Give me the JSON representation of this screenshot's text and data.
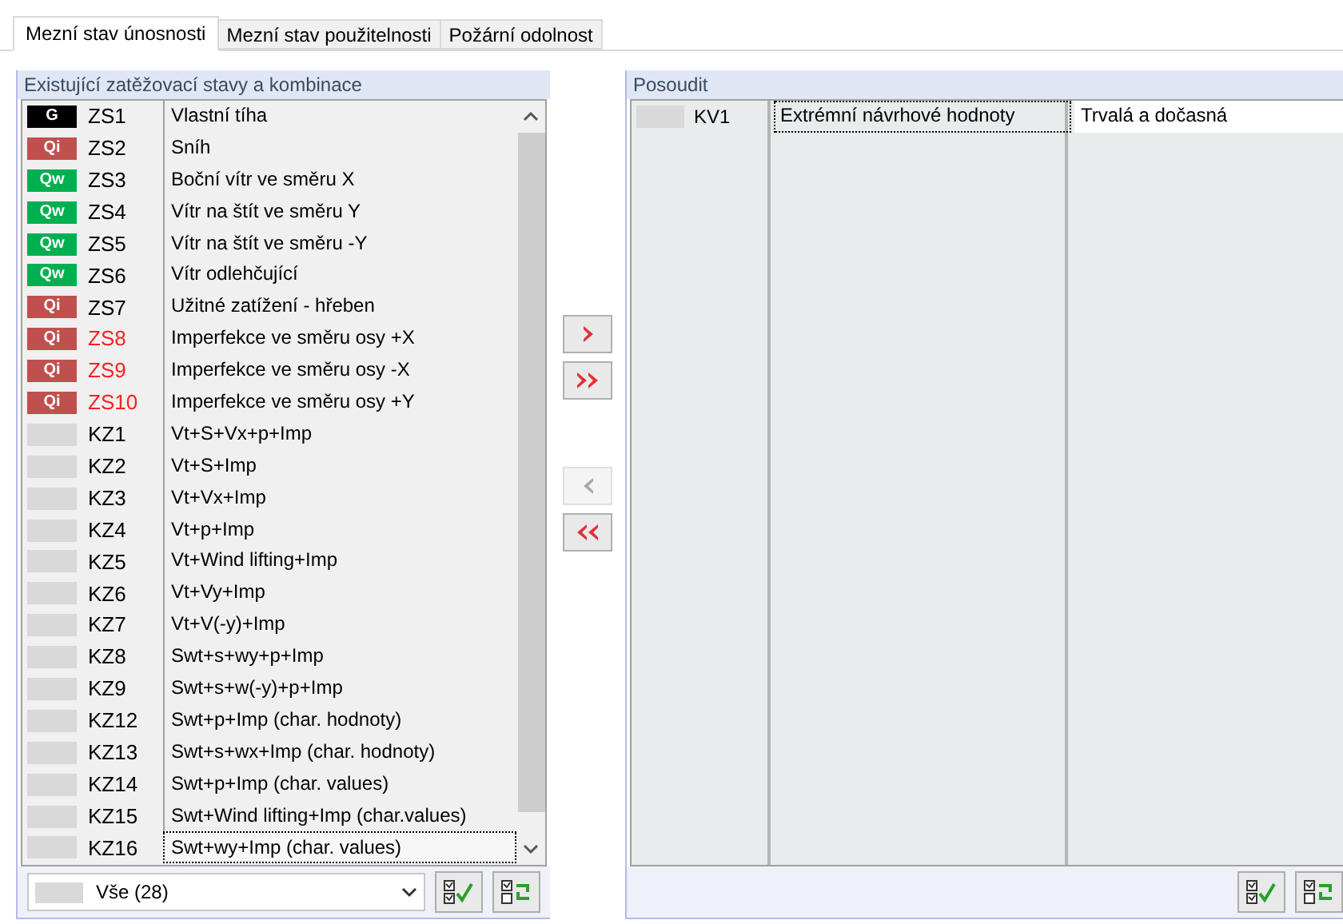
{
  "tabs": [
    {
      "label": "Mezní stav únosnosti",
      "selected": true
    },
    {
      "label": "Mezní stav použitelnosti",
      "selected": false
    },
    {
      "label": "Požární odolnost",
      "selected": false
    }
  ],
  "existing": {
    "title": "Existující zatěžovací stavy a kombinace",
    "rows": [
      {
        "kind": "permanent",
        "badge": "G",
        "id": "ZS1",
        "name": "Vlastní tíha",
        "flagged": false,
        "focused": false
      },
      {
        "kind": "imposed",
        "badge": "Qi",
        "id": "ZS2",
        "name": "Sníh",
        "flagged": false,
        "focused": false
      },
      {
        "kind": "wind",
        "badge": "Qw",
        "id": "ZS3",
        "name": "Boční vítr ve směru X",
        "flagged": false,
        "focused": false
      },
      {
        "kind": "wind",
        "badge": "Qw",
        "id": "ZS4",
        "name": "Vítr na štít ve směru Y",
        "flagged": false,
        "focused": false
      },
      {
        "kind": "wind",
        "badge": "Qw",
        "id": "ZS5",
        "name": "Vítr na štít ve směru -Y",
        "flagged": false,
        "focused": false
      },
      {
        "kind": "wind",
        "badge": "Qw",
        "id": "ZS6",
        "name": "Vítr odlehčující",
        "flagged": false,
        "focused": false
      },
      {
        "kind": "imposed",
        "badge": "Qi",
        "id": "ZS7",
        "name": "Užitné zatížení - hřeben",
        "flagged": false,
        "focused": false
      },
      {
        "kind": "imposed",
        "badge": "Qi",
        "id": "ZS8",
        "name": "Imperfekce ve směru osy +X",
        "flagged": true,
        "focused": false
      },
      {
        "kind": "imposed",
        "badge": "Qi",
        "id": "ZS9",
        "name": "Imperfekce ve směru osy -X",
        "flagged": true,
        "focused": false
      },
      {
        "kind": "imposed",
        "badge": "Qi",
        "id": "ZS10",
        "name": "Imperfekce ve směru osy +Y",
        "flagged": true,
        "focused": false
      },
      {
        "kind": "combination",
        "id": "KZ1",
        "name": "Vt+S+Vx+p+Imp",
        "flagged": false,
        "focused": false
      },
      {
        "kind": "combination",
        "id": "KZ2",
        "name": "Vt+S+Imp",
        "flagged": false,
        "focused": false
      },
      {
        "kind": "combination",
        "id": "KZ3",
        "name": "Vt+Vx+Imp",
        "flagged": false,
        "focused": false
      },
      {
        "kind": "combination",
        "id": "KZ4",
        "name": "Vt+p+Imp",
        "flagged": false,
        "focused": false
      },
      {
        "kind": "combination",
        "id": "KZ5",
        "name": "Vt+Wind lifting+Imp",
        "flagged": false,
        "focused": false
      },
      {
        "kind": "combination",
        "id": "KZ6",
        "name": "Vt+Vy+Imp",
        "flagged": false,
        "focused": false
      },
      {
        "kind": "combination",
        "id": "KZ7",
        "name": "Vt+V(-y)+Imp",
        "flagged": false,
        "focused": false
      },
      {
        "kind": "combination",
        "id": "KZ8",
        "name": "Swt+s+wy+p+Imp",
        "flagged": false,
        "focused": false
      },
      {
        "kind": "combination",
        "id": "KZ9",
        "name": "Swt+s+w(-y)+p+Imp",
        "flagged": false,
        "focused": false
      },
      {
        "kind": "combination",
        "id": "KZ12",
        "name": "Swt+p+Imp (char. hodnoty)",
        "flagged": false,
        "focused": false
      },
      {
        "kind": "combination",
        "id": "KZ13",
        "name": "Swt+s+wx+Imp (char. hodnoty)",
        "flagged": false,
        "focused": false
      },
      {
        "kind": "combination",
        "id": "KZ14",
        "name": "Swt+p+Imp (char. values)",
        "flagged": false,
        "focused": false
      },
      {
        "kind": "combination",
        "id": "KZ15",
        "name": "Swt+Wind lifting+Imp (char.values)",
        "flagged": false,
        "focused": false
      },
      {
        "kind": "combination",
        "id": "KZ16",
        "name": "Swt+wy+Imp (char. values)",
        "flagged": false,
        "focused": true
      }
    ],
    "filter": {
      "value": "Vše (28)"
    }
  },
  "transfer_buttons": [
    {
      "kind": "add",
      "disabled": false
    },
    {
      "kind": "add-all",
      "disabled": false
    },
    {
      "kind": "remove",
      "disabled": true
    },
    {
      "kind": "remove-all",
      "disabled": false
    }
  ],
  "check": {
    "title": "Posoudit",
    "rows": [
      {
        "id": "KV1",
        "design": "Extrémní návrhové hodnoty",
        "situation": "Trvalá a dočasná"
      }
    ]
  }
}
